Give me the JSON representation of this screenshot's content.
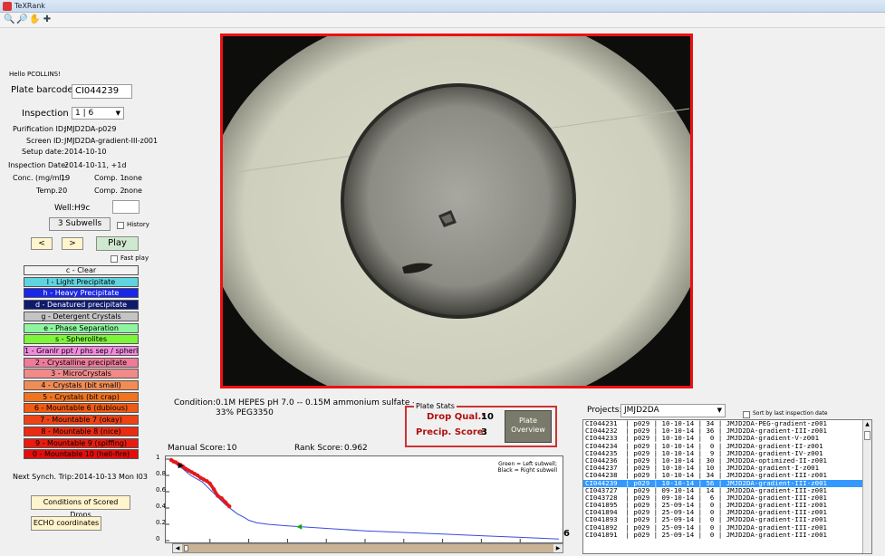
{
  "window": {
    "title": "TeXRank"
  },
  "toolbar": {
    "icons": [
      "zoom-in-icon",
      "zoom-out-icon",
      "pan-hand-icon",
      "data-cursor-icon"
    ]
  },
  "left": {
    "greeting": "Hello PCOLLINS!",
    "plate_barcode_label": "Plate barcode:",
    "plate_barcode": "CI044239",
    "inspection_label": "Inspection #:",
    "inspection_value": "1 | 6",
    "purification_label": "Purification ID:",
    "purification": "JMJD2DA-p029",
    "screen_label": "Screen ID:",
    "screen": "JMJD2DA-gradient-III-z001",
    "setup_label": "Setup date:",
    "setup": "2014-10-10",
    "inspection_date_label": "Inspection Date:",
    "inspection_date": "2014-10-11, +1d",
    "conc_label": "Conc. (mg/ml):",
    "conc": "19",
    "temp_label": "Temp.:",
    "temp": "20",
    "comp1_label": "Comp. 1:",
    "comp1": "none",
    "comp2_label": "Comp. 2:",
    "comp2": "none",
    "well_label": "Well:",
    "well": "H9c",
    "subwells_button": "3 Subwells",
    "history_label": "History",
    "prev_button": "<",
    "next_button": ">",
    "play_button": "Play",
    "fast_play_label": "Fast play",
    "next_synch_label": "Next Synch. Trip:",
    "next_synch": "2014-10-13 Mon I03",
    "conditions_button": "Conditions of Scored Drops",
    "echo_button": "ECHO coordinates"
  },
  "categories": [
    {
      "label": "c - Clear",
      "color": "#f2f2f2",
      "text": "#000000"
    },
    {
      "label": "l - Light Precipitate",
      "color": "#5fd4e0",
      "text": "#000000"
    },
    {
      "label": "h - Heavy Precipitate",
      "color": "#1a26e8",
      "text": "#ffffff"
    },
    {
      "label": "d - Denatured precipitate",
      "color": "#0d1a6e",
      "text": "#ffffff"
    },
    {
      "label": "g - Detergent Crystals",
      "color": "#c4c4c4",
      "text": "#000000"
    },
    {
      "label": "e - Phase Separation",
      "color": "#8ef5a0",
      "text": "#000000"
    },
    {
      "label": "s - Spherolites",
      "color": "#7cf53a",
      "text": "#000000"
    },
    {
      "label": "1 - Granlr ppt / phs sep / spherlts",
      "color": "#f28be0",
      "text": "#000000"
    },
    {
      "label": "2 - Crystalline precipitate",
      "color": "#f07a9a",
      "text": "#000000"
    },
    {
      "label": "3 - MicroCrystals",
      "color": "#f28a8a",
      "text": "#000000"
    },
    {
      "label": "4 - Crystals (bit small)",
      "color": "#f28c55",
      "text": "#000000"
    },
    {
      "label": "5 - Crystals (bit crap)",
      "color": "#f2741e",
      "text": "#000000"
    },
    {
      "label": "6 - Mountable 6 (dubious)",
      "color": "#ef5a14",
      "text": "#000000"
    },
    {
      "label": "7 - Mountable 7 (okay)",
      "color": "#ee4214",
      "text": "#000000"
    },
    {
      "label": "8 - Mountable 8 (nice)",
      "color": "#ec2a10",
      "text": "#000000"
    },
    {
      "label": "9 - Mountable 9 (spiffing)",
      "color": "#ea1a10",
      "text": "#000000"
    },
    {
      "label": "0 - Mountable 10 (hell-fire)",
      "color": "#e40d0d",
      "text": "#000000"
    }
  ],
  "center": {
    "condition_label": "Condition:",
    "condition_line1": "0.1M HEPES pH 7.0 -- 0.15M ammonium sulfate --",
    "condition_line2": "33% PEG3350",
    "plate_stats_title": "Plate Stats",
    "drop_qual_label": "Drop Qual.:",
    "drop_qual": "10",
    "precip_label": "Precip. Score:",
    "precip": "3",
    "plate_overview_line1": "Plate",
    "plate_overview_line2": "Overview",
    "manual_score_label": "Manual Score:",
    "manual_score": "10",
    "rank_score_label": "Rank Score:",
    "rank_score": "0.962",
    "plot_legend_line1": "Green = Left subwell;",
    "plot_legend_line2": "Black = Right subwell",
    "plot_end_value": "6"
  },
  "chart_data": {
    "type": "line",
    "title": "",
    "xlabel": "",
    "ylabel": "",
    "ylim": [
      0,
      1
    ],
    "yticks": [
      "0",
      "0.2",
      "0.4",
      "0.6",
      "0.8",
      "1"
    ],
    "series": [
      {
        "color": "#3a4be0",
        "x": [
          0,
          1,
          3,
          5,
          8,
          11,
          14,
          17,
          19,
          20,
          22,
          25,
          30,
          40,
          50,
          60,
          70,
          80,
          90,
          100
        ],
        "y": [
          0.99,
          0.95,
          0.88,
          0.8,
          0.72,
          0.58,
          0.44,
          0.33,
          0.28,
          0.25,
          0.22,
          0.2,
          0.18,
          0.15,
          0.12,
          0.1,
          0.08,
          0.06,
          0.04,
          0.02
        ]
      },
      {
        "color": "#e11a1a",
        "x": [
          0,
          0.6,
          1.2,
          1.8,
          2.4,
          3,
          3.8,
          4.5,
          5.3,
          6,
          6.8,
          7.6,
          8.4,
          9.2,
          10,
          11,
          12,
          13,
          14,
          15
        ],
        "y": [
          0.99,
          0.97,
          0.96,
          0.94,
          0.93,
          0.91,
          0.88,
          0.86,
          0.84,
          0.82,
          0.8,
          0.77,
          0.75,
          0.73,
          0.7,
          0.63,
          0.55,
          0.52,
          0.47,
          0.42
        ]
      }
    ],
    "markers": [
      {
        "label": "right-subwell",
        "x": 2.5,
        "y": 0.92,
        "color": "#000000"
      },
      {
        "label": "left-subwell",
        "x": 33,
        "y": 0.17,
        "color": "#1aa01a"
      }
    ]
  },
  "right": {
    "projects_label": "Projects:",
    "project": "JMJD2DA",
    "sort_label": "Sort by last inspection date",
    "rows": [
      "CI044231  | p029 | 10-10-14 | 34 | JMJD2DA-PEG-gradient-z001",
      "CI044232  | p029 | 10-10-14 | 36 | JMJD2DA-gradient-III-z001",
      "CI044233  | p029 | 10-10-14 |  0 | JMJD2DA-gradient-V-z001",
      "CI044234  | p029 | 10-10-14 |  0 | JMJD2DA-gradient-II-z001",
      "CI044235  | p029 | 10-10-14 |  9 | JMJD2DA-gradient-IV-z001",
      "CI044236  | p029 | 10-10-14 | 30 | JMJD2DA-optimized-II-z001",
      "CI044237  | p029 | 10-10-14 | 10 | JMJD2DA-gradient-I-z001",
      "CI044238  | p029 | 10-10-14 | 34 | JMJD2DA-gradient-III-z001",
      "CI044239  | p029 | 10-10-14 | 56 | JMJD2DA-gradient-III-z001",
      "CI043727  | p029 | 09-10-14 | 14 | JMJD2DA-gradient-III-z001",
      "CI043728  | p029 | 09-10-14 |  6 | JMJD2DA-gradient-III-z001",
      "CI041895  | p029 | 25-09-14 |  0 | JMJD2DA-gradient-III-z001",
      "CI041894  | p029 | 25-09-14 |  0 | JMJD2DA-gradient-III-z001",
      "CI041893  | p029 | 25-09-14 |  0 | JMJD2DA-gradient-III-z001",
      "CI041892  | p029 | 25-09-14 |  0 | JMJD2DA-gradient-III-z001",
      "CI041891  | p029 | 25-09-14 |  0 | JMJD2DA-gradient-III-z001"
    ],
    "selected_index": 8
  }
}
